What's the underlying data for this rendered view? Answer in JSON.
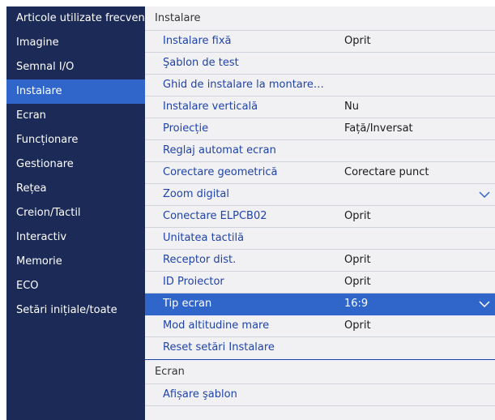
{
  "sidebar": {
    "items": [
      {
        "label": "Articole utilizate frecvent"
      },
      {
        "label": "Imagine"
      },
      {
        "label": "Semnal I/O"
      },
      {
        "label": "Instalare"
      },
      {
        "label": "Ecran"
      },
      {
        "label": "Funcționare"
      },
      {
        "label": "Gestionare"
      },
      {
        "label": "Rețea"
      },
      {
        "label": "Creion/Tactil"
      },
      {
        "label": "Interactiv"
      },
      {
        "label": "Memorie"
      },
      {
        "label": "ECO"
      },
      {
        "label": "Setări inițiale/toate"
      }
    ],
    "active_index": 3
  },
  "main": {
    "section1_title": "Instalare",
    "rows": [
      {
        "label": "Instalare fixă",
        "value": "Oprit"
      },
      {
        "label": "Şablon de test",
        "value": ""
      },
      {
        "label": "Ghid de instalare la montare…",
        "value": ""
      },
      {
        "label": "Instalare verticală",
        "value": "Nu"
      },
      {
        "label": "Proiecție",
        "value": "Față/Inversat"
      },
      {
        "label": "Reglaj automat ecran",
        "value": ""
      },
      {
        "label": "Corectare geometrică",
        "value": "Corectare punct"
      },
      {
        "label": "Zoom digital",
        "value": "",
        "chevron": "chevron-down-icon"
      },
      {
        "label": "Conectare ELPCB02",
        "value": "Oprit"
      },
      {
        "label": "Unitatea tactilă",
        "value": ""
      },
      {
        "label": "Receptor dist.",
        "value": "Oprit"
      },
      {
        "label": "ID Proiector",
        "value": "Oprit"
      },
      {
        "label": "Tip ecran",
        "value": "16:9",
        "chevron": "chevron-down-icon",
        "selected": true
      },
      {
        "label": "Mod altitudine mare",
        "value": "Oprit"
      },
      {
        "label": "Reset setări Instalare",
        "value": ""
      }
    ],
    "section2_title": "Ecran",
    "section2_rows": [
      {
        "label": "Afișare şablon",
        "value": ""
      }
    ]
  },
  "colors": {
    "sidebar_bg": "#1b2a56",
    "accent": "#3066c9",
    "link_text": "#1f43a8",
    "panel_bg": "#f1f1f4"
  }
}
